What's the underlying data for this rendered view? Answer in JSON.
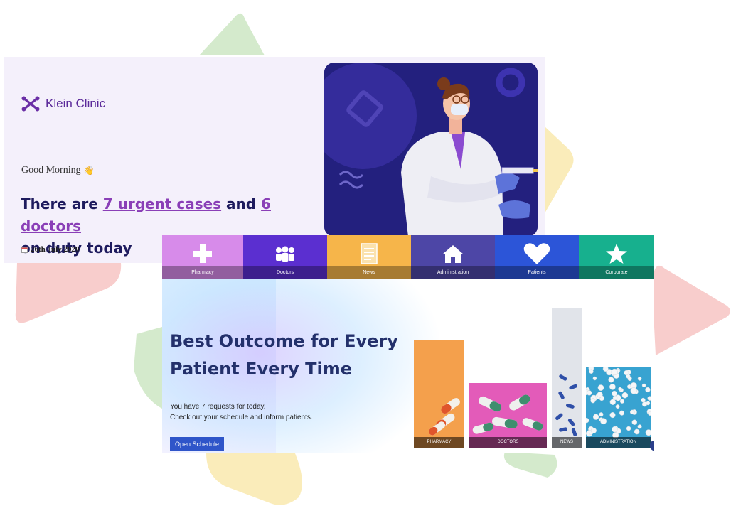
{
  "brand": {
    "name": "Klein Clinic",
    "icon": "x-cross-logo-icon",
    "color": "#5b2a9a"
  },
  "greeting": {
    "text": "Good Morning",
    "emoji": "👋"
  },
  "headline": {
    "prefix": "There are ",
    "urgent_link": "7 urgent cases",
    "middle": " and ",
    "doctors_link": "6 doctors",
    "suffix": "on duty today"
  },
  "date": {
    "icon": "calendar-icon",
    "text": "26th July 2020"
  },
  "tiles": [
    {
      "label": "Pharmacy",
      "icon": "plus-icon",
      "color": "#d78bea"
    },
    {
      "label": "Doctors",
      "icon": "people-icon",
      "color": "#5b2fd0"
    },
    {
      "label": "News",
      "icon": "document-icon",
      "color": "#f6b54a"
    },
    {
      "label": "Administration",
      "icon": "home-icon",
      "color": "#4d46a6"
    },
    {
      "label": "Patients",
      "icon": "heart-icon",
      "color": "#2c55d8"
    },
    {
      "label": "Corporate",
      "icon": "star-icon",
      "color": "#17b08e"
    }
  ],
  "promo": {
    "title": "Best Outcome for Every Patient Every Time",
    "line1": "You have 7 requests for today.",
    "line2": "Check out your schedule and inform patients.",
    "button": "Open Schedule"
  },
  "photos": [
    {
      "caption": "PHARMACY"
    },
    {
      "caption": "DOCTORS"
    },
    {
      "caption": "NEWS"
    },
    {
      "caption": "ADMINISTRATION"
    }
  ]
}
